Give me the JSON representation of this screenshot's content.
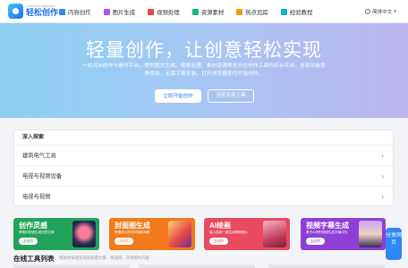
{
  "brand": {
    "name": "轻松创作",
    "slogan": "PURE AIGC CREATION",
    "color": "#1f6fe8"
  },
  "nav": {
    "items": [
      {
        "label": "内容创作",
        "icon": "document-icon",
        "color": "#3b82f6"
      },
      {
        "label": "图片生成",
        "icon": "image-icon",
        "color": "#a855f7"
      },
      {
        "label": "视频处理",
        "icon": "video-icon",
        "color": "#ef4444"
      },
      {
        "label": "资源素材",
        "icon": "folder-icon",
        "color": "#10b981"
      },
      {
        "label": "热点追踪",
        "icon": "flame-icon",
        "color": "#f59e0b"
      },
      {
        "label": "经验教程",
        "icon": "book-icon",
        "color": "#06b6d4"
      }
    ],
    "language": "简体中文"
  },
  "hero": {
    "title": "轻量创作，让创意轻松实现",
    "description": "一站式AI创作与素材平台，提供图文生成、视频处理、素材资源等全方位创作工具的综合平台，全部功能免费使用，无需下载安装，打开浏览器即可开始创作。",
    "primary_button": "立即开始创作",
    "secondary_button": "浏览全部工具"
  },
  "explore": {
    "heading": "深入探索",
    "items": [
      "建筑电气工具",
      "电视与视频设备",
      "电视与视频"
    ]
  },
  "cards": [
    {
      "title": "创作灵感",
      "subtitle": "帮助你快速生成创意文案",
      "button": "去创作",
      "color": "#22a35a"
    },
    {
      "title": "封面图生成",
      "subtitle": "快速设计原创封面和海报",
      "button": "去创作",
      "color": "#f27a1a"
    },
    {
      "title": "AI绘画",
      "subtitle": "输入描述一键生成精美图片",
      "button": "去创作",
      "color": "#e84a5f"
    },
    {
      "title": "视频字幕生成",
      "subtitle": "基于AI识别视频生成字幕文件",
      "button": "去创作",
      "color": "#8e3fd6"
    }
  ],
  "float_button": "分享网页",
  "tools_section": {
    "title": "在线工具列表",
    "subtitle": "帮助你快速生成高质量文章，你选择，开始图片内容"
  }
}
